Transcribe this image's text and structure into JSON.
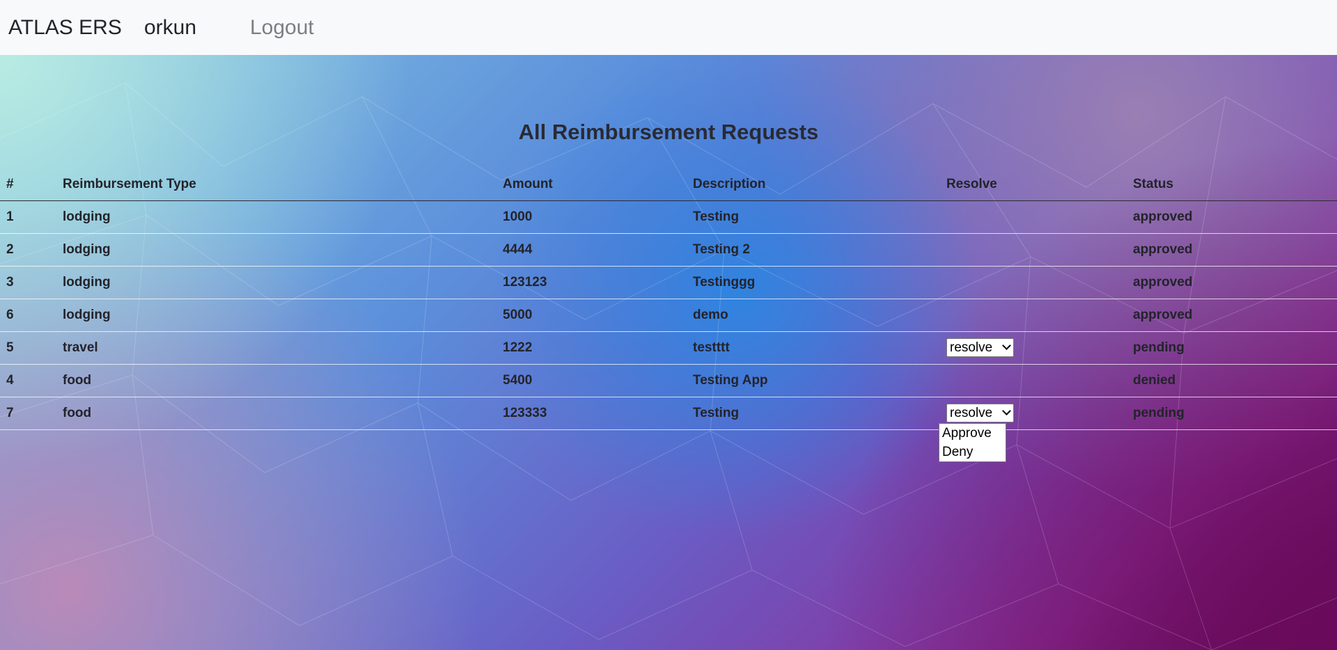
{
  "nav": {
    "brand": "ATLAS ERS",
    "username": "orkun",
    "logout_label": "Logout"
  },
  "page": {
    "title": "All Reimbursement Requests"
  },
  "table": {
    "headers": [
      "#",
      "Reimbursement Type",
      "Amount",
      "Description",
      "Resolve",
      "Status"
    ],
    "rows": [
      {
        "id": "1",
        "type": "lodging",
        "amount": "1000",
        "description": "Testing",
        "resolve": "",
        "status": "approved"
      },
      {
        "id": "2",
        "type": "lodging",
        "amount": "4444",
        "description": "Testing 2",
        "resolve": "",
        "status": "approved"
      },
      {
        "id": "3",
        "type": "lodging",
        "amount": "123123",
        "description": "Testinggg",
        "resolve": "",
        "status": "approved"
      },
      {
        "id": "6",
        "type": "lodging",
        "amount": "5000",
        "description": "demo",
        "resolve": "",
        "status": "approved"
      },
      {
        "id": "5",
        "type": "travel",
        "amount": "1222",
        "description": "testttt",
        "resolve": "resolve",
        "status": "pending"
      },
      {
        "id": "4",
        "type": "food",
        "amount": "5400",
        "description": "Testing App",
        "resolve": "",
        "status": "denied"
      },
      {
        "id": "7",
        "type": "food",
        "amount": "123333",
        "description": "Testing",
        "resolve": "resolve",
        "status": "pending"
      }
    ]
  },
  "resolve_dropdown": {
    "options": [
      "Approve",
      "Deny"
    ]
  }
}
